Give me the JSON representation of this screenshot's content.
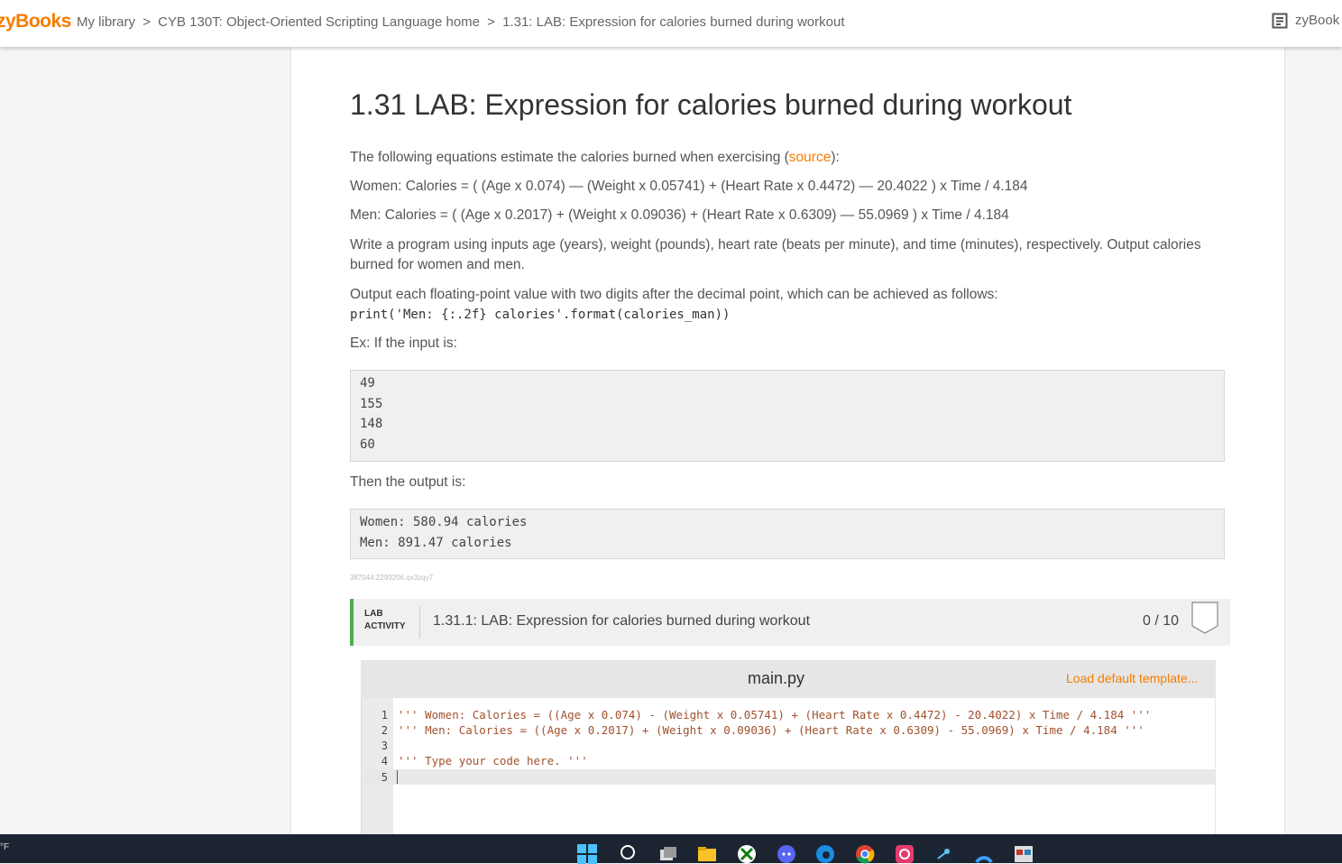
{
  "header": {
    "logo": "zyBooks",
    "breadcrumb": [
      "My library",
      ">",
      "CYB 130T: Object-Oriented Scripting Language home",
      ">",
      "1.31: LAB: Expression for calories burned during workout"
    ],
    "right_label": "zyBook"
  },
  "section": {
    "title": "1.31 LAB: Expression for calories burned during workout",
    "intro_prefix": "The following equations estimate the calories burned when exercising (",
    "intro_link": "source",
    "intro_suffix": "):",
    "women_formula": "Women: Calories = ( (Age x 0.074) — (Weight x 0.05741) + (Heart Rate x 0.4472) — 20.4022 ) x Time / 4.184",
    "men_formula": "Men: Calories = ( (Age x 0.2017) + (Weight x 0.09036) + (Heart Rate x 0.6309) — 55.0969 ) x Time / 4.184",
    "instructions": "Write a program using inputs age (years), weight (pounds), heart rate (beats per minute), and time (minutes), respectively. Output calories burned for women and men.",
    "format_note": "Output each floating-point value with two digits after the decimal point, which can be achieved as follows:",
    "format_code": "print('Men: {:.2f} calories'.format(calories_man))",
    "input_intro": "Ex: If the input is:",
    "input_lines": [
      "49",
      "155",
      "148",
      "60"
    ],
    "output_intro": "Then the output is:",
    "output_lines": [
      "Women: 580.94 calories",
      "Men: 891.47 calories"
    ],
    "tracking_id": "387044.2293206.qx3zqy7"
  },
  "lab": {
    "tag_line1": "LAB",
    "tag_line2": "ACTIVITY",
    "title": "1.31.1: LAB: Expression for calories burned during workout",
    "score": "0 / 10"
  },
  "editor": {
    "filename": "main.py",
    "load_template": "Load default template...",
    "lines": [
      "''' Women: Calories = ((Age x 0.074) - (Weight x 0.05741) + (Heart Rate x 0.4472) - 20.4022) x Time / 4.184 '''",
      "''' Men: Calories = ((Age x 0.2017) + (Weight x 0.09036) + (Heart Rate x 0.6309) - 55.0969) x Time / 4.184 '''",
      "",
      "''' Type your code here. '''",
      ""
    ],
    "line_numbers": [
      "1",
      "2",
      "3",
      "4",
      "5"
    ]
  },
  "taskbar": {
    "weather": "°F",
    "icons": [
      "windows-start-icon",
      "search-icon",
      "task-view-icon",
      "file-explorer-icon",
      "xbox-icon",
      "discord-icon",
      "edge-icon",
      "chrome-icon",
      "app-icon",
      "steam-icon",
      "arc-icon",
      "app-window-icon"
    ]
  },
  "colors": {
    "accent": "#f57c00",
    "lab_bar": "#4caf50",
    "taskbar": "#1c2431"
  }
}
